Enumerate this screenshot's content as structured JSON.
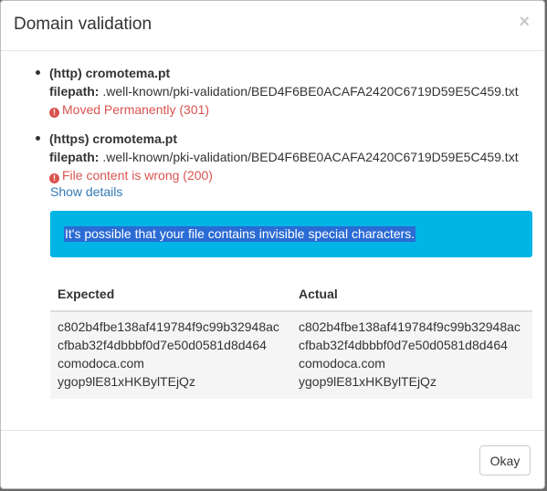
{
  "dialog": {
    "title": "Domain validation",
    "close_glyph": "×"
  },
  "checks": [
    {
      "protocol_domain": "(http) cromotema.pt",
      "filepath_label": "filepath:",
      "filepath": ".well-known/pki-validation/BED4F6BE0ACAFA2420C6719D59E5C459.txt",
      "error": "Moved Permanently (301)"
    },
    {
      "protocol_domain": "(https) cromotema.pt",
      "filepath_label": "filepath:",
      "filepath": ".well-known/pki-validation/BED4F6BE0ACAFA2420C6719D59E5C459.txt",
      "error": "File content is wrong (200)"
    }
  ],
  "show_details": "Show details",
  "alert": "It's possible that your file contains invisible special characters.",
  "comparison": {
    "headers": [
      "Expected",
      "Actual"
    ],
    "expected": [
      "c802b4fbe138af419784f9c99b32948ac",
      "cfbab32f4dbbbf0d7e50d0581d8d464",
      "comodoca.com",
      "ygop9lE81xHKBylTEjQz"
    ],
    "actual": [
      "c802b4fbe138af419784f9c99b32948ac",
      "cfbab32f4dbbbf0d7e50d0581d8d464",
      "comodoca.com",
      "ygop9lE81xHKBylTEjQz"
    ]
  },
  "footer": {
    "ok_label": "Okay"
  },
  "colors": {
    "error": "#d9534f",
    "link": "#337ab7",
    "alert_bg": "#00b4e6",
    "selection": "#2a6bd4"
  },
  "icons": {
    "error_icon": "exclamation-circle-icon"
  }
}
